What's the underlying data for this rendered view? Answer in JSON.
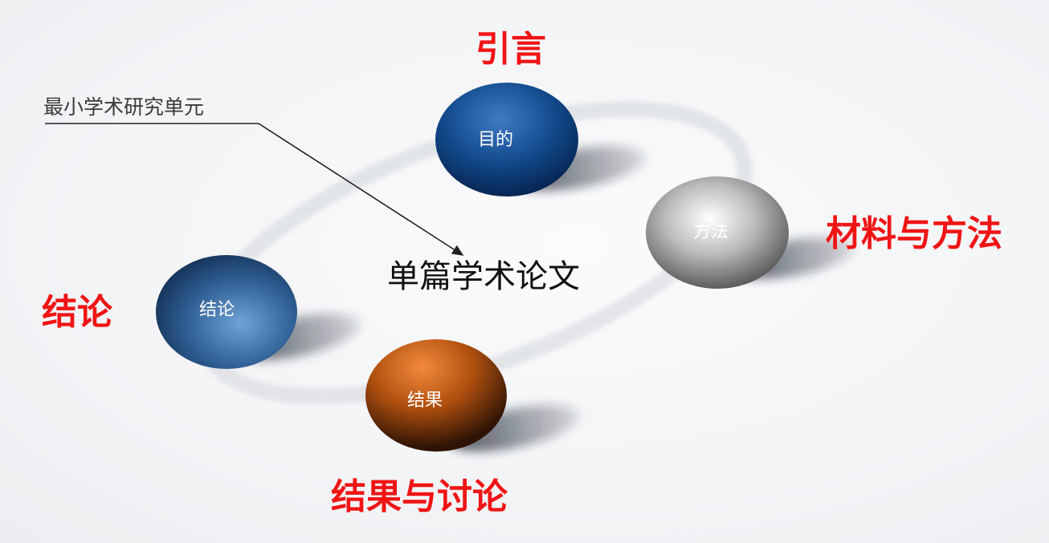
{
  "annotation": {
    "text": "最小学术研究单元"
  },
  "center_title": "单篇学术论文",
  "nodes": [
    {
      "id": "purpose",
      "ball_label": "目的",
      "outer_label": "引言",
      "color": "#0d3a78"
    },
    {
      "id": "method",
      "ball_label": "方法",
      "outer_label": "材料与方法",
      "color": "#8a8a8a"
    },
    {
      "id": "result",
      "ball_label": "结果",
      "outer_label": "结果与讨论",
      "color": "#b5520f"
    },
    {
      "id": "conclusion",
      "ball_label": "结论",
      "outer_label": "结论",
      "color": "#2e5f92"
    }
  ],
  "colors": {
    "label_red": "#f01414",
    "ring": "#dfe1e4"
  }
}
